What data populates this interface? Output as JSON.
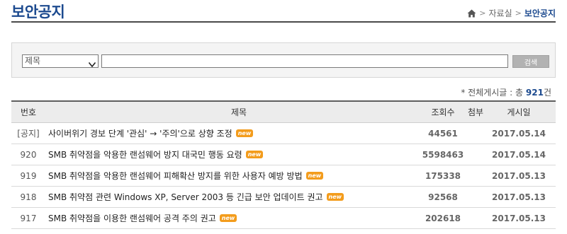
{
  "header": {
    "title": "보안공지",
    "breadcrumb": {
      "parent": "자료실",
      "current": "보안공지",
      "separator": ">"
    }
  },
  "search": {
    "field_selected": "제목",
    "query": "",
    "button_label": "검색"
  },
  "summary": {
    "prefix": "* 전체게시글 : 총",
    "count": "921",
    "suffix": "건"
  },
  "table": {
    "columns": {
      "number": "번호",
      "title": "제목",
      "views": "조회수",
      "attach": "첨부",
      "date": "게시일"
    },
    "badge_label": "new",
    "rows": [
      {
        "number": "[공지]",
        "title": "사이버위기 경보 단계 '관심' → '주의'으로 상향 조정",
        "views": "44561",
        "date": "2017.05.14"
      },
      {
        "number": "920",
        "title": "SMB 취약점을 악용한 랜섬웨어 방지 대국민 행동 요령",
        "views": "5598463",
        "date": "2017.05.14"
      },
      {
        "number": "919",
        "title": "SMB 취약점을 악용한 랜섬웨어 피해확산 방지를 위한 사용자 예방 방법",
        "views": "175338",
        "date": "2017.05.13"
      },
      {
        "number": "918",
        "title": "SMB 취약점 관련 Windows XP, Server 2003 등 긴급 보안 업데이트 권고",
        "views": "92568",
        "date": "2017.05.13"
      },
      {
        "number": "917",
        "title": "SMB 취약점을 이용한 랜섬웨어 공격 주의 권고",
        "views": "202618",
        "date": "2017.05.13"
      }
    ]
  },
  "colors": {
    "title_blue": "#1c4a8f",
    "badge_orange": "#f39c1c"
  },
  "icons": {
    "home": "home-icon",
    "select_caret": "chevron-down-icon"
  }
}
